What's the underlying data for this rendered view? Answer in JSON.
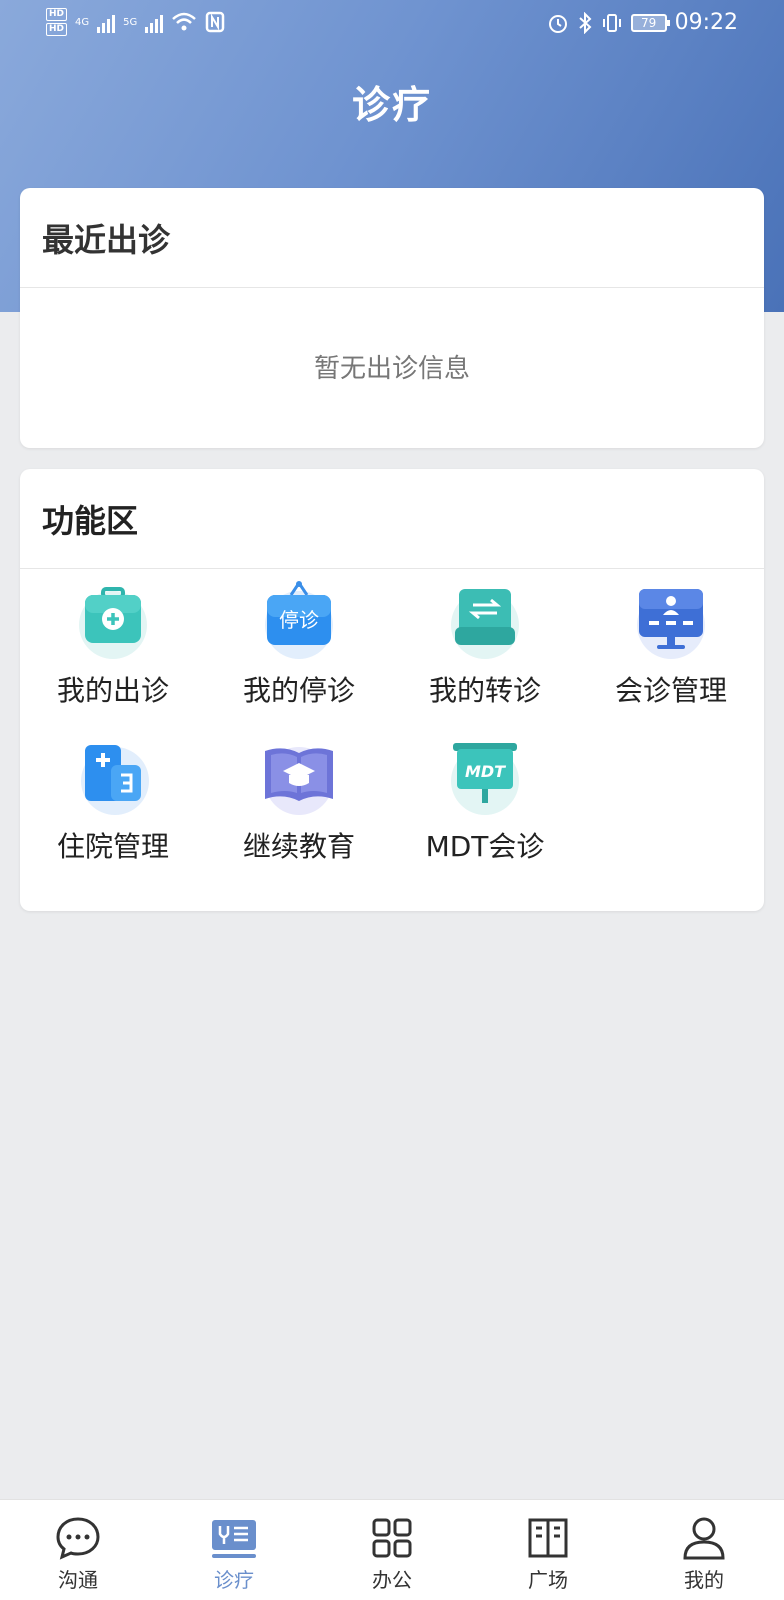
{
  "status_bar": {
    "hd1": "HD",
    "hd2": "HD",
    "net1": "4G",
    "net2": "5G",
    "battery": "79",
    "time": "09:22"
  },
  "header": {
    "title": "诊疗"
  },
  "recent": {
    "title": "最近出诊",
    "empty_text": "暂无出诊信息"
  },
  "functions": {
    "title": "功能区",
    "items": [
      {
        "label": "我的出诊",
        "icon": "medical-kit-icon"
      },
      {
        "label": "我的停诊",
        "icon": "stop-clinic-icon",
        "badge": "停诊"
      },
      {
        "label": "我的转诊",
        "icon": "referral-icon"
      },
      {
        "label": "会诊管理",
        "icon": "consultation-icon"
      },
      {
        "label": "住院管理",
        "icon": "hospital-icon"
      },
      {
        "label": "继续教育",
        "icon": "education-book-icon"
      },
      {
        "label": "MDT会诊",
        "icon": "mdt-board-icon",
        "badge": "MDT"
      }
    ]
  },
  "tabbar": {
    "items": [
      {
        "label": "沟通",
        "icon": "chat-icon"
      },
      {
        "label": "诊疗",
        "icon": "clinic-icon",
        "active": true
      },
      {
        "label": "办公",
        "icon": "grid-icon"
      },
      {
        "label": "广场",
        "icon": "book-icon"
      },
      {
        "label": "我的",
        "icon": "user-icon"
      }
    ]
  },
  "colors": {
    "header_start": "#8aa9db",
    "header_end": "#4a72b8",
    "active_tab": "#6a8fcc",
    "background": "#ebecee"
  }
}
